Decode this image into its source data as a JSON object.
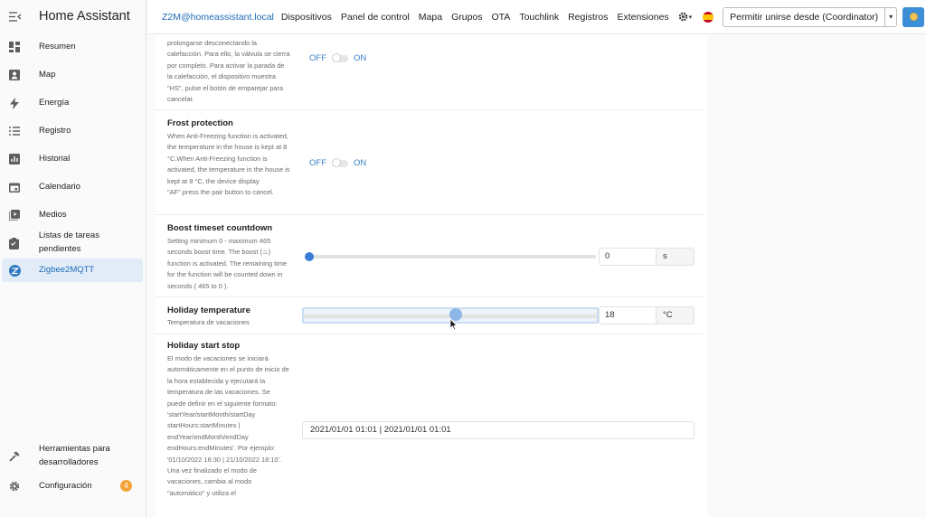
{
  "sidebar": {
    "title": "Home Assistant",
    "items": [
      {
        "label": "Resumen",
        "icon": "dashboard-icon"
      },
      {
        "label": "Map",
        "icon": "map-icon"
      },
      {
        "label": "Energía",
        "icon": "lightning-icon"
      },
      {
        "label": "Registro",
        "icon": "list-icon"
      },
      {
        "label": "Historial",
        "icon": "chart-icon"
      },
      {
        "label": "Calendario",
        "icon": "calendar-icon"
      },
      {
        "label": "Medios",
        "icon": "media-icon"
      },
      {
        "label": "Listas de tareas pendientes",
        "icon": "clipboard-icon"
      },
      {
        "label": "Zigbee2MQTT",
        "icon": "zigbee-icon",
        "active": true
      }
    ],
    "bottom": [
      {
        "label": "Herramientas para desarrolladores",
        "icon": "hammer-icon"
      },
      {
        "label": "Configuración",
        "icon": "cog-icon",
        "badge": "4"
      }
    ]
  },
  "topnav": {
    "brand": "Z2M@homeassistant.local",
    "links": [
      "Dispositivos",
      "Panel de control",
      "Mapa",
      "Grupos",
      "OTA",
      "Touchlink",
      "Registros",
      "Extensiones"
    ],
    "permit_join_label": "Permitir unirse desde (Coordinator)"
  },
  "rows": {
    "partial": {
      "desc": "prolongarse desconectando la calefacción. Para ello, la válvula se cierra por completo. Para activar la parada de la calefacción, el dispositivo muestra \"HS\", pulse el botón de emparejar para cancelar.",
      "off": "OFF",
      "on": "ON"
    },
    "frost": {
      "name": "Frost protection",
      "desc": "When Anti-Freezing function is activated, the temperature in the house is kept at 8 °C.When Anti-Freezing function is activated, the temperature in the house is kept at 8 °C, the device display \"AF\".press the pair button to cancel.",
      "off": "OFF",
      "on": "ON"
    },
    "boost": {
      "name": "Boost timeset countdown",
      "desc": "Setting minimum 0 - maximum 465 seconds boost time. The boost (♨) function is activated. The remaining time for the function will be counted down in seconds ( 465 to 0 ).",
      "value": "0",
      "unit": "s",
      "level": 0.0
    },
    "holiday_temp": {
      "name": "Holiday temperature",
      "desc": "Temperatura de vacaciones",
      "value": "18",
      "unit": "°C",
      "level": 0.52
    },
    "holiday_start": {
      "name": "Holiday start stop",
      "desc": "El modo de vacaciones se iniciará automáticamente en el punto de inicio de la hora establecida y ejecutará la temperatura de las vacaciones. Se puede definir en el siguiente formato: 'startYear/startMonth/startDay startHours:startMinutes | endYear/endMonth/endDay endHours:endMinutes'. Por ejemplo: '01/10/2022 16:30 | 21/10/2022 18:10'. Una vez finalizado el modo de vacaciones, cambia al modo \"automático\" y utiliza el",
      "value": "2021/01/01 01:01 | 2021/01/01 01:01"
    }
  }
}
